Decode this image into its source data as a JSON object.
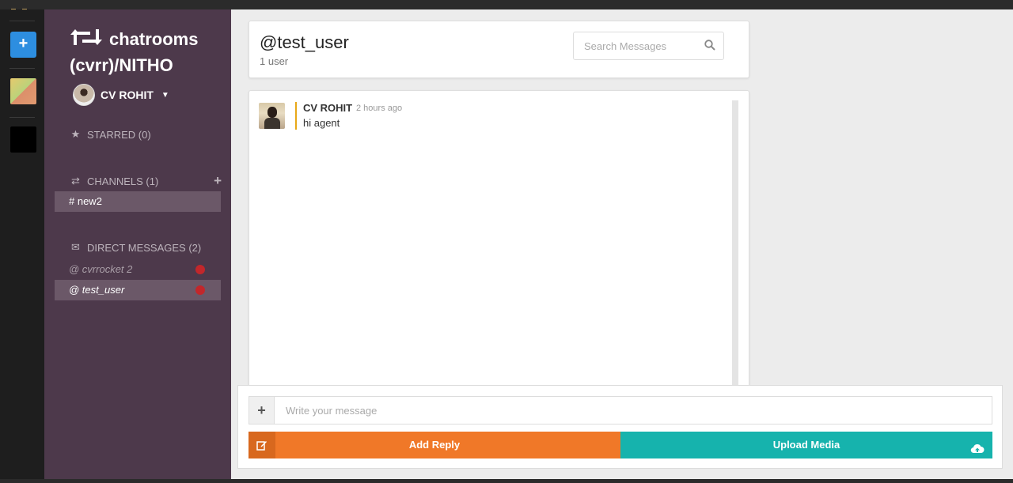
{
  "workspace": {
    "name": "chatrooms (cvrr)/NITHO",
    "user_name": "CV ROHIT"
  },
  "rail": {
    "add_label": "+"
  },
  "sidebar": {
    "starred_label": "STARRED (0)",
    "channels_label": "CHANNELS (1)",
    "channels": [
      {
        "label": "# new2",
        "active": true
      }
    ],
    "dm_label": "DIRECT MESSAGES (2)",
    "direct_messages": [
      {
        "label": "@ cvrrocket 2",
        "status": "offline"
      },
      {
        "label": "@ test_user",
        "status": "offline",
        "active": true
      }
    ]
  },
  "header": {
    "title": "@test_user",
    "subtitle": "1 user",
    "search_placeholder": "Search Messages"
  },
  "messages": [
    {
      "author": "CV ROHIT",
      "time": "2 hours ago",
      "text": "hi agent"
    }
  ],
  "composer": {
    "attach_label": "+",
    "placeholder": "Write your message",
    "reply_label": "Add Reply",
    "upload_label": "Upload Media"
  },
  "colors": {
    "sidebar": "#4d394b",
    "accent_blue": "#2d8ee0",
    "reply": "#f07828",
    "upload": "#16b3ad",
    "status_dot": "#c2272b",
    "message_bar": "#e8a818"
  }
}
